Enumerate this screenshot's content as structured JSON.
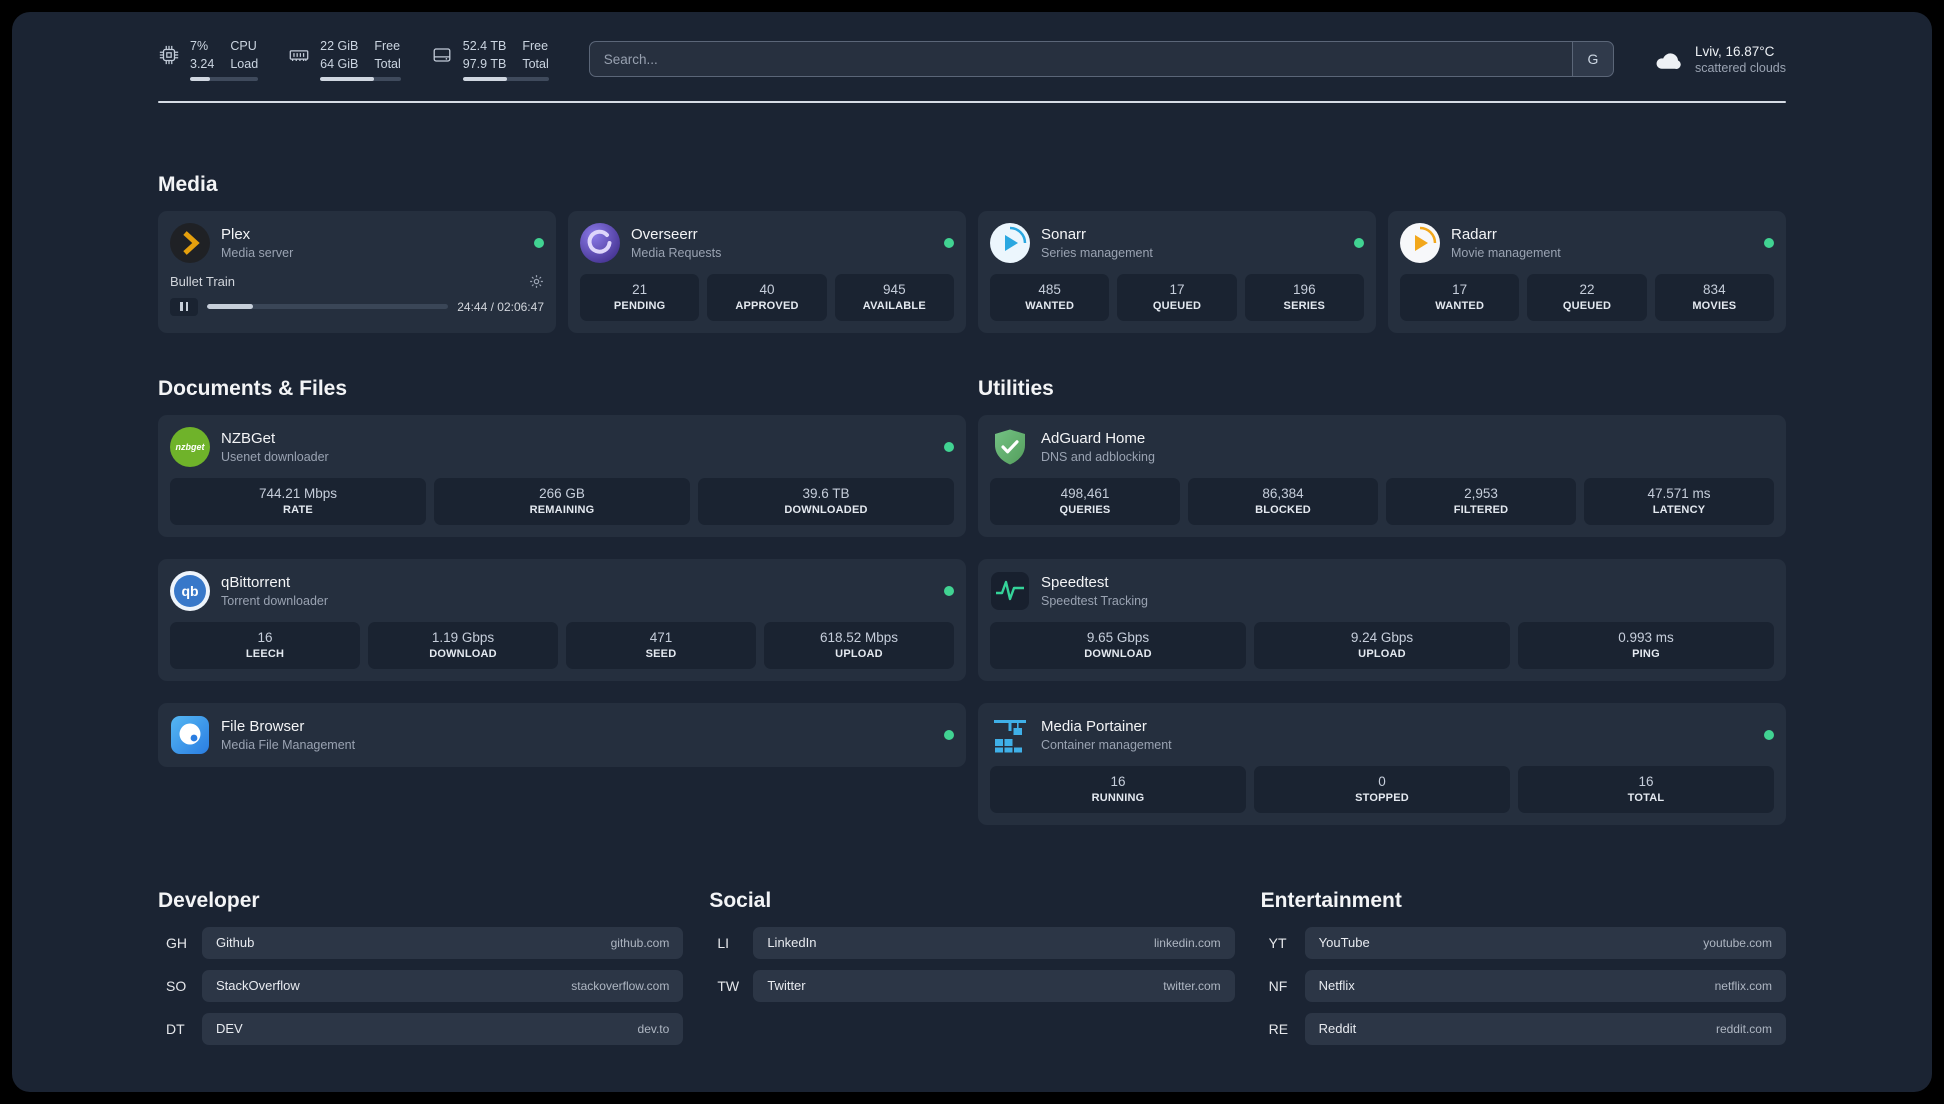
{
  "topbar": {
    "cpu": {
      "value_top": "7%",
      "label_top": "CPU",
      "value_bottom": "3.24",
      "label_bottom": "Load",
      "bar_percent": 30
    },
    "memory": {
      "value_top": "22 GiB",
      "label_top": "Free",
      "value_bottom": "64 GiB",
      "label_bottom": "Total",
      "bar_percent": 67
    },
    "disk": {
      "value_top": "52.4 TB",
      "label_top": "Free",
      "value_bottom": "97.9 TB",
      "label_bottom": "Total",
      "bar_percent": 52
    },
    "search": {
      "placeholder": "Search...",
      "button_label": "G"
    },
    "weather": {
      "location": "Lviv, 16.87°C",
      "condition": "scattered clouds"
    }
  },
  "sections": {
    "media": "Media",
    "documents": "Documents & Files",
    "utilities": "Utilities",
    "developer": "Developer",
    "social": "Social",
    "entertainment": "Entertainment"
  },
  "services": {
    "plex": {
      "name": "Plex",
      "desc": "Media server",
      "now_playing": "Bullet Train",
      "time": "24:44 / 02:06:47",
      "progress_percent": 19
    },
    "overseerr": {
      "name": "Overseerr",
      "desc": "Media Requests",
      "stats": [
        {
          "value": "21",
          "label": "PENDING"
        },
        {
          "value": "40",
          "label": "APPROVED"
        },
        {
          "value": "945",
          "label": "AVAILABLE"
        }
      ]
    },
    "sonarr": {
      "name": "Sonarr",
      "desc": "Series management",
      "stats": [
        {
          "value": "485",
          "label": "WANTED"
        },
        {
          "value": "17",
          "label": "QUEUED"
        },
        {
          "value": "196",
          "label": "SERIES"
        }
      ]
    },
    "radarr": {
      "name": "Radarr",
      "desc": "Movie management",
      "stats": [
        {
          "value": "17",
          "label": "WANTED"
        },
        {
          "value": "22",
          "label": "QUEUED"
        },
        {
          "value": "834",
          "label": "MOVIES"
        }
      ]
    },
    "nzbget": {
      "name": "NZBGet",
      "desc": "Usenet downloader",
      "stats": [
        {
          "value": "744.21 Mbps",
          "label": "RATE"
        },
        {
          "value": "266 GB",
          "label": "REMAINING"
        },
        {
          "value": "39.6 TB",
          "label": "DOWNLOADED"
        }
      ]
    },
    "qbittorrent": {
      "name": "qBittorrent",
      "desc": "Torrent downloader",
      "stats": [
        {
          "value": "16",
          "label": "LEECH"
        },
        {
          "value": "1.19 Gbps",
          "label": "DOWNLOAD"
        },
        {
          "value": "471",
          "label": "SEED"
        },
        {
          "value": "618.52 Mbps",
          "label": "UPLOAD"
        }
      ]
    },
    "filebrowser": {
      "name": "File Browser",
      "desc": "Media File Management"
    },
    "adguard": {
      "name": "AdGuard Home",
      "desc": "DNS and adblocking",
      "stats": [
        {
          "value": "498,461",
          "label": "QUERIES"
        },
        {
          "value": "86,384",
          "label": "BLOCKED"
        },
        {
          "value": "2,953",
          "label": "FILTERED"
        },
        {
          "value": "47.571 ms",
          "label": "LATENCY"
        }
      ]
    },
    "speedtest": {
      "name": "Speedtest",
      "desc": "Speedtest Tracking",
      "stats": [
        {
          "value": "9.65 Gbps",
          "label": "DOWNLOAD"
        },
        {
          "value": "9.24 Gbps",
          "label": "UPLOAD"
        },
        {
          "value": "0.993 ms",
          "label": "PING"
        }
      ]
    },
    "portainer": {
      "name": "Media Portainer",
      "desc": "Container management",
      "stats": [
        {
          "value": "16",
          "label": "RUNNING"
        },
        {
          "value": "0",
          "label": "STOPPED"
        },
        {
          "value": "16",
          "label": "TOTAL"
        }
      ]
    }
  },
  "bookmarks": {
    "developer": [
      {
        "abbr": "GH",
        "name": "Github",
        "url": "github.com"
      },
      {
        "abbr": "SO",
        "name": "StackOverflow",
        "url": "stackoverflow.com"
      },
      {
        "abbr": "DT",
        "name": "DEV",
        "url": "dev.to"
      }
    ],
    "social": [
      {
        "abbr": "LI",
        "name": "LinkedIn",
        "url": "linkedin.com"
      },
      {
        "abbr": "TW",
        "name": "Twitter",
        "url": "twitter.com"
      }
    ],
    "entertainment": [
      {
        "abbr": "YT",
        "name": "YouTube",
        "url": "youtube.com"
      },
      {
        "abbr": "NF",
        "name": "Netflix",
        "url": "netflix.com"
      },
      {
        "abbr": "RE",
        "name": "Reddit",
        "url": "reddit.com"
      }
    ]
  },
  "theme": {
    "status_green": "#41d392",
    "accent_blue": "#3fb0e8"
  }
}
